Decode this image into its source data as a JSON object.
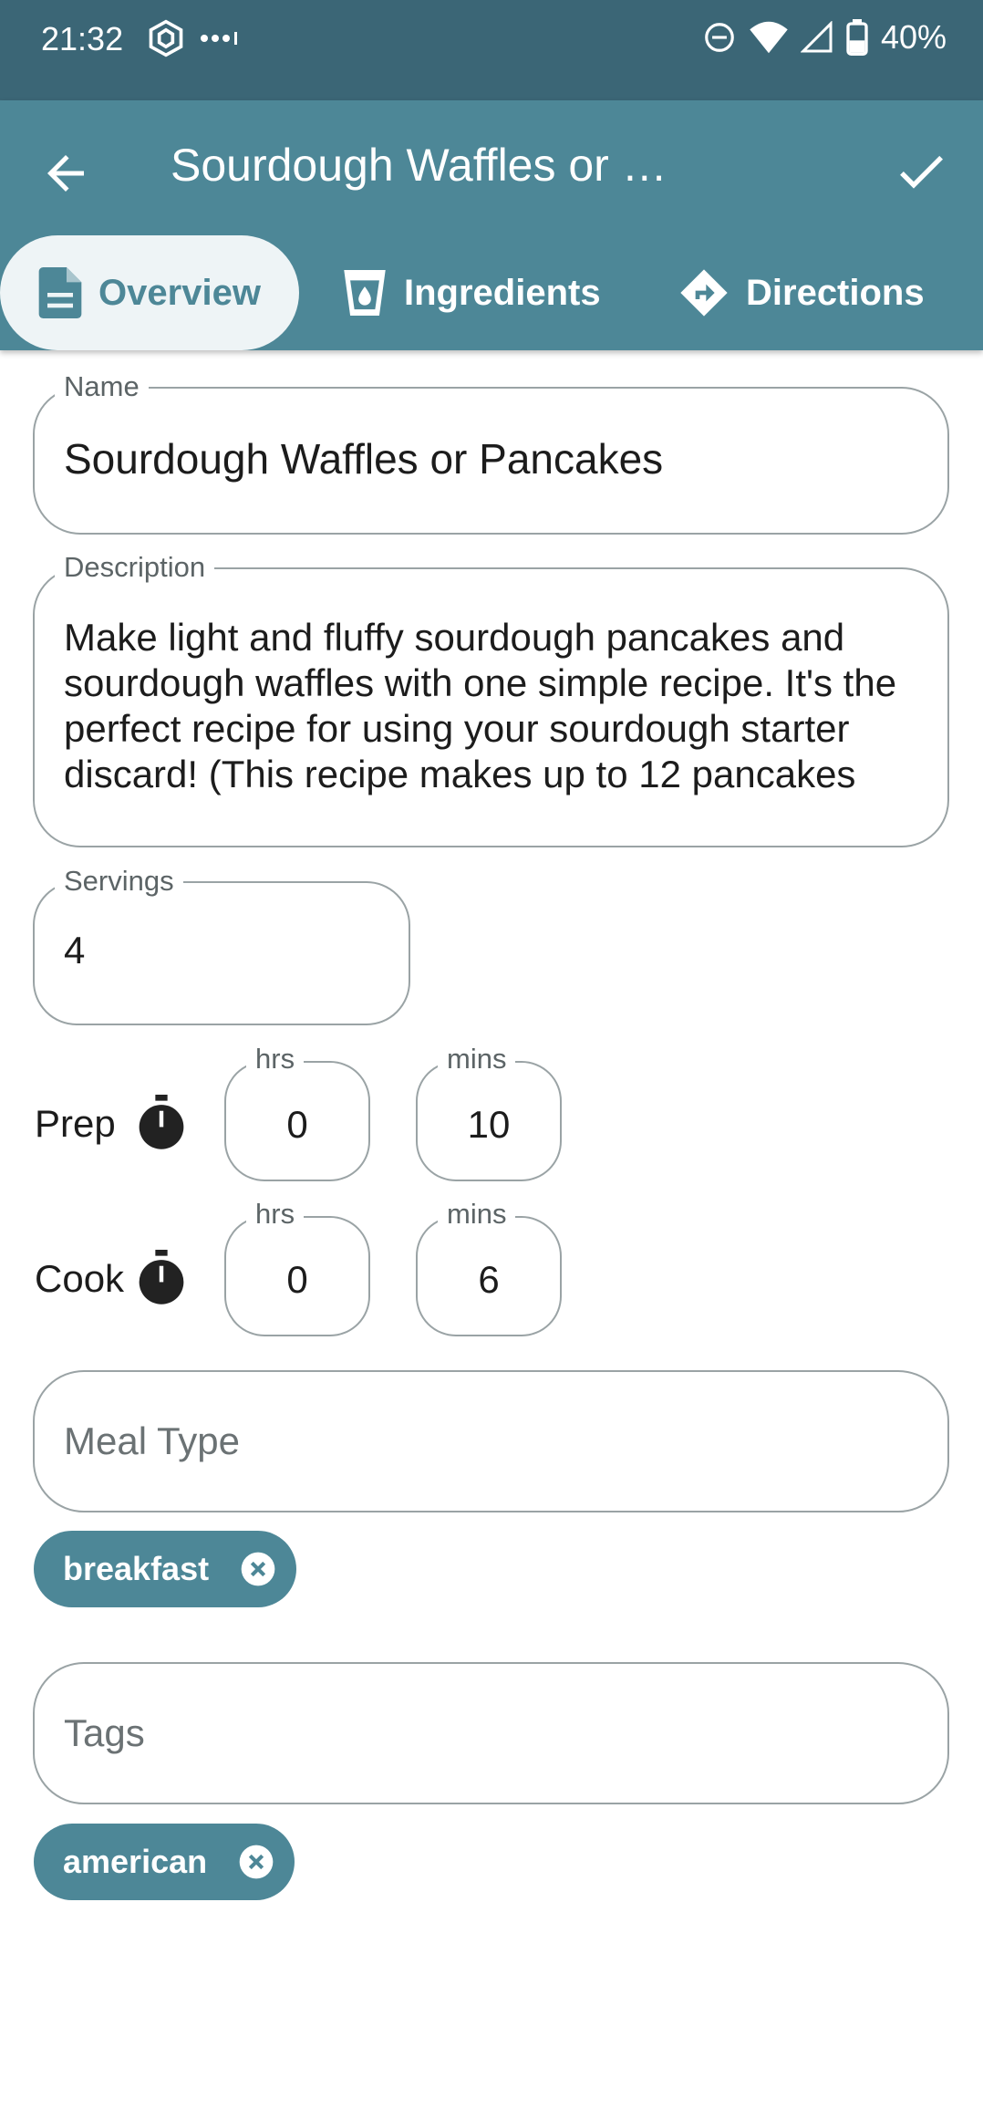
{
  "status": {
    "time": "21:32",
    "battery": "40%",
    "icons": [
      "hexagon-app-icon",
      "more-dots-icon",
      "dnd-icon",
      "wifi-icon",
      "signal-icon",
      "battery-icon"
    ]
  },
  "appbar": {
    "title": "Sourdough Waffles or …",
    "back_icon": "arrow-left-icon",
    "save_icon": "check-icon"
  },
  "tabs": [
    {
      "label": "Overview",
      "icon": "document-icon",
      "selected": true
    },
    {
      "label": "Ingredients",
      "icon": "cup-icon",
      "selected": false
    },
    {
      "label": "Directions",
      "icon": "directions-icon",
      "selected": false
    }
  ],
  "form": {
    "name": {
      "label": "Name",
      "value": "Sourdough Waffles or Pancakes"
    },
    "description": {
      "label": "Description",
      "value": "Make light and fluffy sourdough pancakes and sourdough waffles with one simple recipe. It's the perfect recipe for using your sourdough starter discard! (This recipe makes up to 12 pancakes"
    },
    "servings": {
      "label": "Servings",
      "value": "4"
    },
    "prep": {
      "label": "Prep",
      "hrs_label": "hrs",
      "hrs": "0",
      "mins_label": "mins",
      "mins": "10"
    },
    "cook": {
      "label": "Cook",
      "hrs_label": "hrs",
      "hrs": "0",
      "mins_label": "mins",
      "mins": "6"
    },
    "meal_type": {
      "placeholder": "Meal Type",
      "chips": [
        "breakfast"
      ]
    },
    "tags": {
      "placeholder": "Tags",
      "chips": [
        "american"
      ]
    }
  },
  "colors": {
    "primary": "#4d8797",
    "status_bar": "#3b6676",
    "tab_selected_bg": "#eef4f6",
    "outline": "#9aa3a5"
  }
}
